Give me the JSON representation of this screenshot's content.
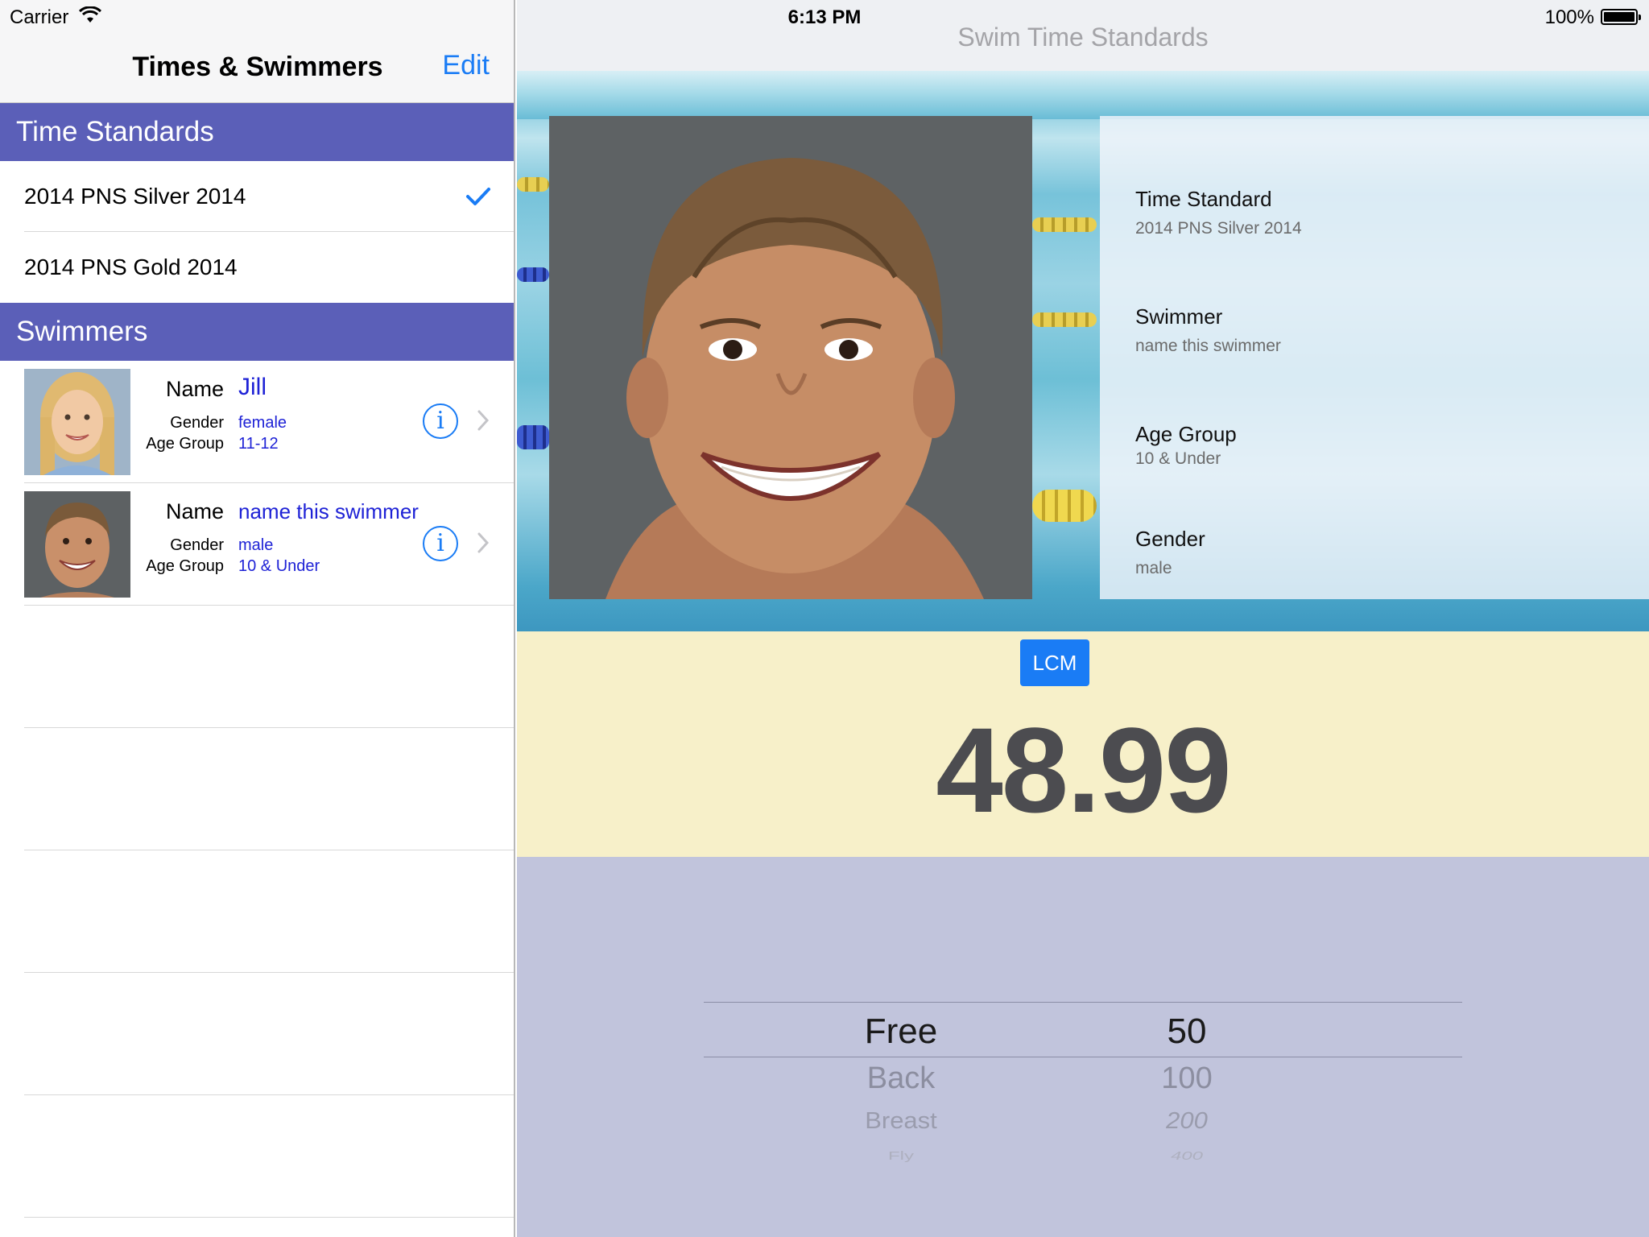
{
  "status_bar": {
    "carrier": "Carrier",
    "time": "6:13 PM",
    "battery": "100%"
  },
  "master": {
    "title": "Times & Swimmers",
    "edit_label": "Edit",
    "time_standards_header": "Time Standards",
    "time_standards": [
      {
        "label": "2014 PNS Silver 2014",
        "selected": true
      },
      {
        "label": "2014 PNS Gold 2014",
        "selected": false
      }
    ],
    "swimmers_header": "Swimmers",
    "field_labels": {
      "name": "Name",
      "gender": "Gender",
      "age_group": "Age Group"
    },
    "swimmers": [
      {
        "name": "Jill",
        "gender": "female",
        "age_group": "11-12"
      },
      {
        "name": "name this swimmer",
        "gender": "male",
        "age_group": "10 & Under"
      }
    ]
  },
  "detail": {
    "title": "Swim Time Standards",
    "info": [
      {
        "key": "Time Standard",
        "value": "2014 PNS Silver 2014"
      },
      {
        "key": "Swimmer",
        "value": "name this swimmer"
      },
      {
        "key": "Age Group",
        "value": "10 & Under"
      },
      {
        "key": "Gender",
        "value": "male"
      }
    ],
    "course_button": "LCM",
    "time": "48.99"
  },
  "picker": {
    "strokes": [
      "Free",
      "Back",
      "Breast",
      "Fly"
    ],
    "distances": [
      "50",
      "100",
      "200",
      "400"
    ],
    "selected_stroke": "Free",
    "selected_distance": "50"
  },
  "colors": {
    "accent": "#1a7cf5",
    "section_header": "#5b5fb8",
    "swimmer_value": "#1e22d6",
    "time_panel": "#f7f0c9",
    "picker_bg": "#c1c4dc"
  },
  "icons": [
    "wifi-icon",
    "battery-icon",
    "checkmark-icon",
    "info-icon",
    "chevron-right-icon"
  ]
}
